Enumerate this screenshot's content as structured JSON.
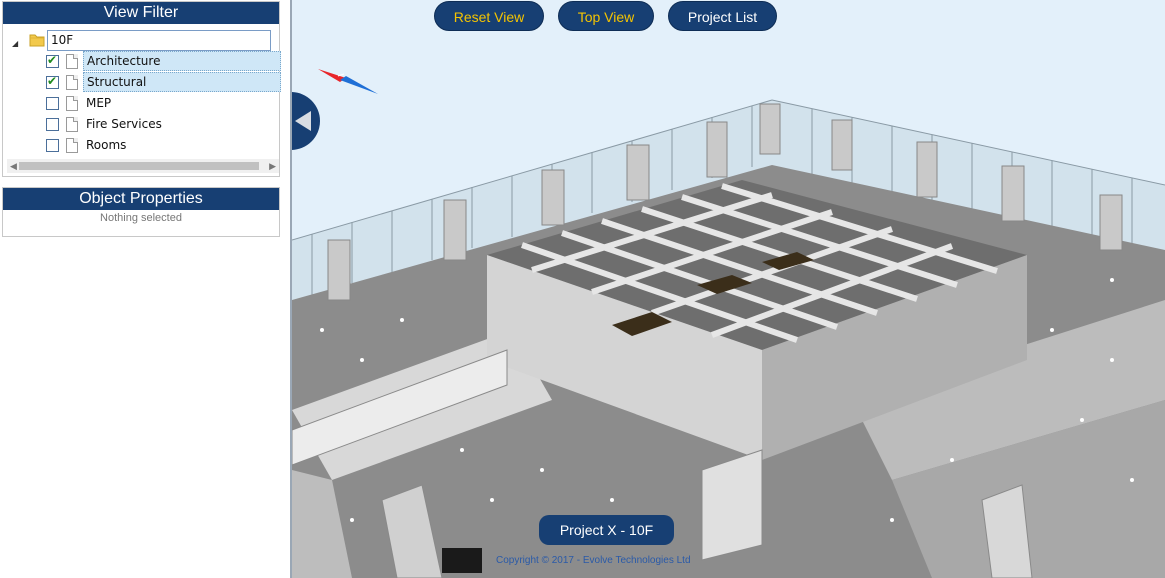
{
  "view_filter": {
    "title": "View Filter",
    "root": {
      "name": "10F",
      "expanded": true,
      "icon": "folder-icon"
    },
    "items": [
      {
        "label": "Architecture",
        "checked": true,
        "selected": true,
        "icon": "document-icon"
      },
      {
        "label": "Structural",
        "checked": true,
        "selected": true,
        "icon": "document-icon"
      },
      {
        "label": "MEP",
        "checked": false,
        "selected": false,
        "icon": "document-icon"
      },
      {
        "label": "Fire Services",
        "checked": false,
        "selected": false,
        "icon": "document-icon"
      },
      {
        "label": "Rooms",
        "checked": false,
        "selected": false,
        "icon": "document-icon"
      }
    ]
  },
  "object_properties": {
    "title": "Object Properties",
    "status": "Nothing selected"
  },
  "toolbar": {
    "reset_view": "Reset View",
    "top_view": "Top View",
    "project_list": "Project List"
  },
  "viewport": {
    "project_label": "Project X - 10F",
    "copyright": "Copyright © 2017 - Evolve Technologies Ltd"
  },
  "colors": {
    "accent": "#173f73",
    "accent_text": "#f5c400",
    "viewport_bg": "#e3f0fa",
    "selection_bg": "#cfe7f7"
  }
}
